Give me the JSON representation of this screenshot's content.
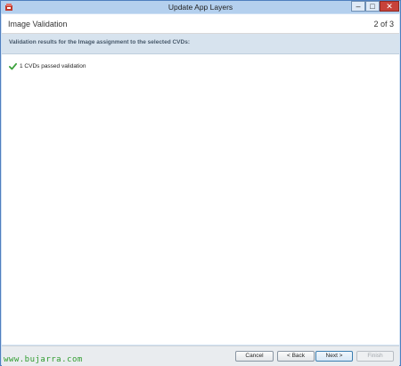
{
  "window": {
    "title": "Update App Layers",
    "min_glyph": "–",
    "max_glyph": "□",
    "close_glyph": "✕"
  },
  "header": {
    "title": "Image Validation",
    "step": "2 of 3"
  },
  "subheader": {
    "text": "Validation results for the Image assignment to the selected CVDs:"
  },
  "results": [
    {
      "status": "passed",
      "text": "1 CVDs passed validation",
      "icon": "checkmark-icon"
    }
  ],
  "footer": {
    "cancel_label": "Cancel",
    "back_label": "< Back",
    "next_label": "Next >",
    "finish_label": "Finish"
  },
  "watermark": {
    "text": "www.bujarra.com"
  },
  "colors": {
    "titlebar": "#b4d0ee",
    "close_button": "#c7423a",
    "subheader_bg": "#d7e3ee",
    "check_green": "#3aa13a",
    "watermark_green": "#2e9c2e"
  }
}
